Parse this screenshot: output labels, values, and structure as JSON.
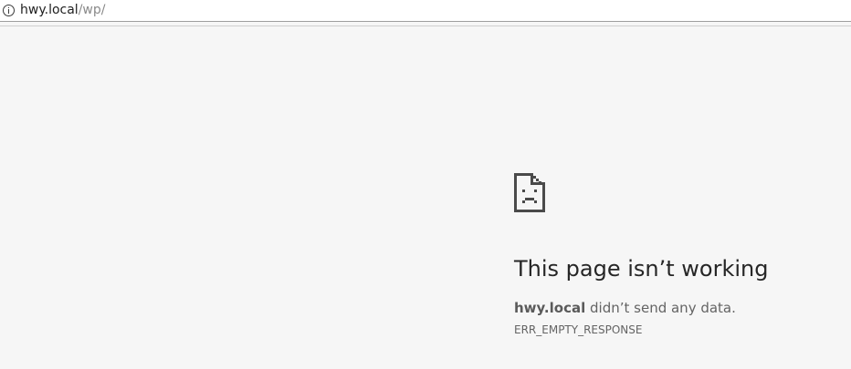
{
  "address_bar": {
    "host": "hwy.local",
    "path": "/wp/",
    "icon": "info-icon"
  },
  "error": {
    "icon": "sad-document-icon",
    "title": "This page isn’t working",
    "host": "hwy.local",
    "message": " didn’t send any data.",
    "code": "ERR_EMPTY_RESPONSE"
  }
}
